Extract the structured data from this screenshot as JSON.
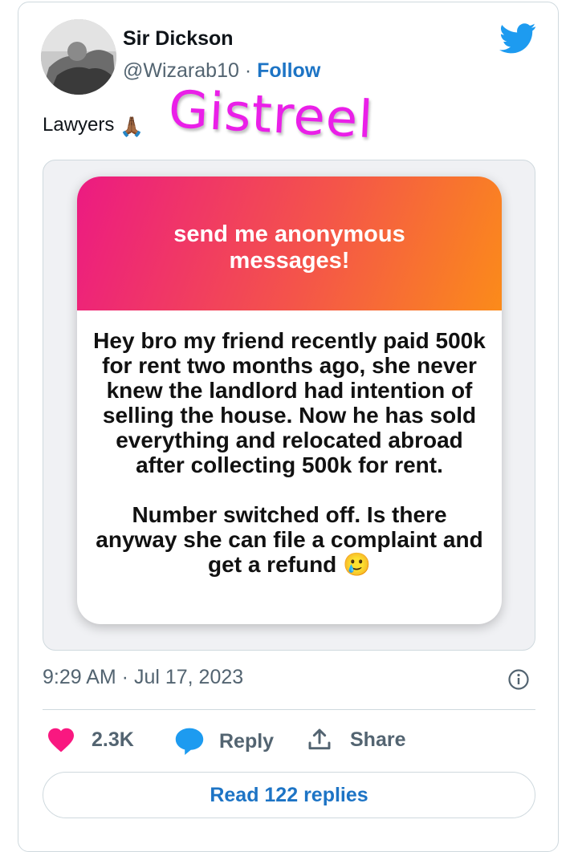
{
  "tweet": {
    "display_name": "Sir Dickson",
    "handle": "@Wizarab10",
    "separator": "·",
    "follow_label": "Follow",
    "text": "Lawyers",
    "text_emoji": "🙏🏾",
    "watermark": "Gistreel",
    "timestamp": "9:29 AM · Jul 17, 2023"
  },
  "media": {
    "header": "send me anonymous messages!",
    "paragraphs": [
      "Hey bro my friend recently paid 500k for rent two months ago, she never knew the landlord had intention of selling the house. Now he has sold everything and relocated abroad after collecting 500k for rent.",
      "Number switched off. Is there anyway she can file a complaint and get a refund 🥲"
    ]
  },
  "actions": {
    "like_count": "2.3K",
    "reply_label": "Reply",
    "share_label": "Share",
    "read_replies_label": "Read 122 replies"
  },
  "colors": {
    "link_blue": "#1d74c5",
    "like_pink": "#f91880",
    "reply_blue": "#1d9bf0",
    "watermark_magenta": "#ea1fe8"
  },
  "icons": [
    "twitter-bird-icon",
    "info-icon",
    "heart-icon",
    "reply-bubble-icon",
    "share-icon"
  ]
}
